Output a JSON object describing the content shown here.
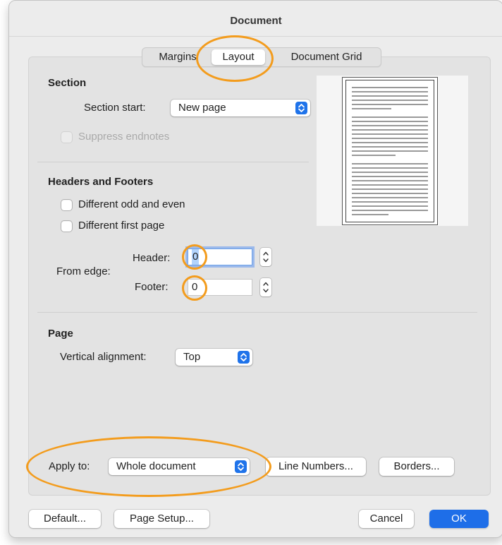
{
  "window": {
    "title": "Document"
  },
  "tabs": [
    "Margins",
    "Layout",
    "Document Grid"
  ],
  "section": {
    "heading": "Section",
    "start_label": "Section start:",
    "start_value": "New page",
    "suppress_label": "Suppress endnotes"
  },
  "headers_footers": {
    "heading": "Headers and Footers",
    "odd_even_label": "Different odd and even",
    "first_page_label": "Different first page",
    "from_edge_label": "From edge:",
    "header_label": "Header:",
    "header_value": "0",
    "footer_label": "Footer:",
    "footer_value": "0"
  },
  "page": {
    "heading": "Page",
    "valign_label": "Vertical alignment:",
    "valign_value": "Top"
  },
  "apply": {
    "label": "Apply to:",
    "value": "Whole document",
    "line_numbers_button": "Line Numbers...",
    "borders_button": "Borders..."
  },
  "footer_buttons": {
    "default": "Default...",
    "page_setup": "Page Setup...",
    "cancel": "Cancel",
    "ok": "OK"
  },
  "colors": {
    "accent": "#1e6ee8",
    "annotation": "#f39c1d"
  }
}
